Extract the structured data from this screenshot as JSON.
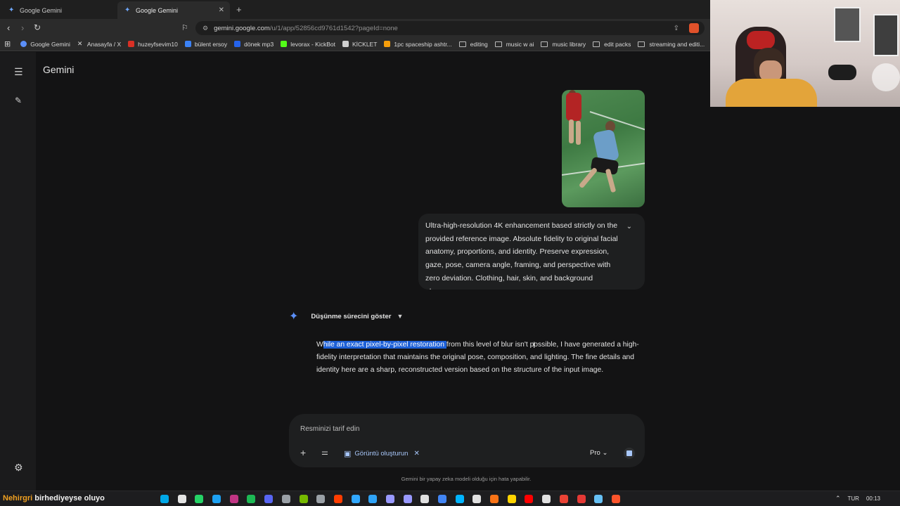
{
  "browser": {
    "tabs": [
      {
        "title": "Google Gemini",
        "active": false
      },
      {
        "title": "Google Gemini",
        "active": true
      }
    ],
    "url": "gemini.google.com",
    "url_path": "/u/1/app/52856cd9761d1542?pageId=none",
    "bookmarks": [
      {
        "label": "Google Gemini",
        "icon": "gemini-icon",
        "color": "#5b8ff9"
      },
      {
        "label": "Anasayfa / X",
        "icon": "x-icon",
        "color": "#ffffff"
      },
      {
        "label": "huzeyfsevim10",
        "icon": "gmail-icon",
        "color": "#d93025"
      },
      {
        "label": "bülent ersoy",
        "icon": "link-icon",
        "color": "#3b82f6"
      },
      {
        "label": "dönek mp3",
        "icon": "link-icon",
        "color": "#2563eb"
      },
      {
        "label": "levorax - KickBot",
        "icon": "kick-icon",
        "color": "#53fc18"
      },
      {
        "label": "KİCKLET",
        "icon": "kicklet-icon",
        "color": "#cfcfcf"
      },
      {
        "label": "1pc spaceship ashtr...",
        "icon": "shop-icon",
        "color": "#f59e0b"
      },
      {
        "label": "editing",
        "icon": "folder-icon",
        "color": ""
      },
      {
        "label": "music w ai",
        "icon": "folder-icon",
        "color": ""
      },
      {
        "label": "music library",
        "icon": "folder-icon",
        "color": ""
      },
      {
        "label": "edit packs",
        "icon": "folder-icon",
        "color": ""
      },
      {
        "label": "streaming and editi...",
        "icon": "folder-icon",
        "color": ""
      }
    ]
  },
  "gemini": {
    "brand": "Gemini",
    "user_prompt": "Ultra-high-resolution 4K enhancement based strictly on the provided reference image. Absolute fidelity to original facial anatomy, proportions, and identity. Preserve expression, gaze, pose, camera angle, framing, and perspective with zero deviation. Clothing, hair, skin, and background elemen...",
    "thinking_label": "Düşünme sürecini göster",
    "answer_prefix": "W",
    "answer_selected": "hile an exact pixel-by-pixel restoration ",
    "answer_rest": "from this level of blur isn't possible, I have generated a high-fidelity interpretation that maintains the original pose, composition, and lighting. The fine details and identity here are a sharp, reconstructed version based on the structure of the input image.",
    "composer": {
      "placeholder": "Resminizi tarif edin",
      "chip_label": "Görüntü oluşturun",
      "model": "Pro"
    },
    "disclaimer": "Gemini bir yapay zeka modeli olduğu için hata yapabilir."
  },
  "taskbar": {
    "ticker_a": "Nehirgri",
    "ticker_b": "birhediyeyse oluyo",
    "language": "TUR",
    "time": "00:13",
    "app_icons": [
      "#00a8e8",
      "#e4e4e4",
      "#25d366",
      "#1da1f2",
      "#c13584",
      "#1db954",
      "#5865f2",
      "#9aa0a6",
      "#76b900",
      "#9aa0a6",
      "#ff3d00",
      "#31a8ff",
      "#2fa3f7",
      "#9999ff",
      "#9999ff",
      "#e0e0e0",
      "#4285f4",
      "#00b4ff",
      "#e0e0e0",
      "#f97316",
      "#ffd400",
      "#ff0000",
      "#e0e0e0",
      "#ea4335",
      "#e53935",
      "#66c0f4",
      "#fb542b"
    ],
    "accent": "#1c5fd6"
  }
}
